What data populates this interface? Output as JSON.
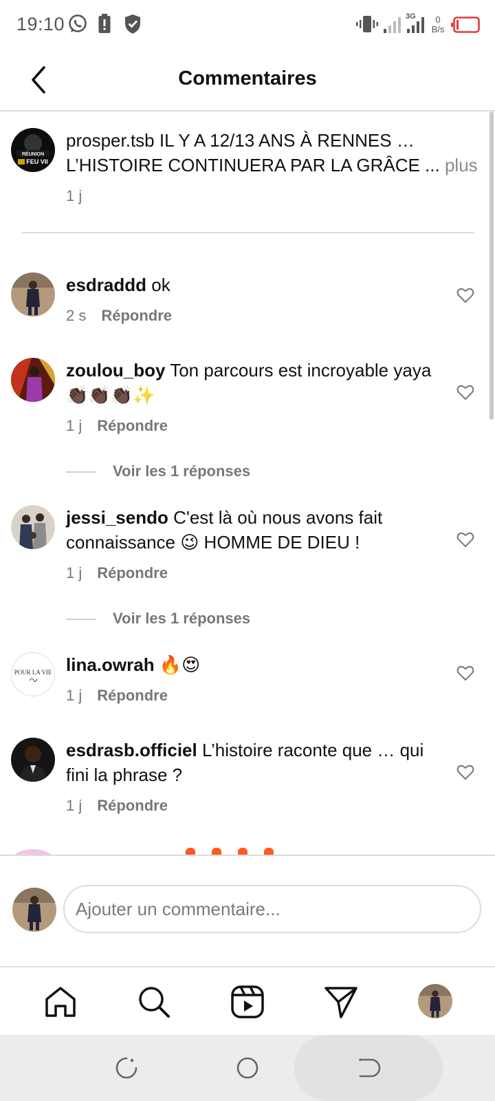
{
  "status": {
    "time": "19:10",
    "net_speed_value": "0",
    "net_speed_unit": "B/s",
    "network_type": "3G"
  },
  "header": {
    "title": "Commentaires"
  },
  "caption": {
    "username": "prosper.tsb",
    "text": "IL Y A 12/13 ANS À RENNES … L’HISTOIRE CONTINUERA PAR LA GRÂCE ...",
    "more": "plus",
    "time": "1 j"
  },
  "comments": [
    {
      "username": "esdraddd",
      "text": "ok",
      "time": "2 s",
      "reply": "Répondre"
    },
    {
      "username": "zoulou_boy",
      "text": "Ton parcours est incroyable yaya 👏🏿👏🏿👏🏿✨",
      "time": "1 j",
      "reply": "Répondre",
      "view_replies": "Voir les 1 réponses"
    },
    {
      "username": "jessi_sendo",
      "text": "C'est là où nous avons fait connaissance 😉 HOMME DE DIEU !",
      "time": "1 j",
      "reply": "Répondre",
      "view_replies": "Voir les 1 réponses"
    },
    {
      "username": "lina.owrah",
      "text": "🔥😍",
      "time": "1 j",
      "reply": "Répondre"
    },
    {
      "username": "esdrasb.officiel",
      "text": "L’histoire raconte que … qui fini la phrase ?",
      "time": "1 j",
      "reply": "Répondre"
    }
  ],
  "composer": {
    "placeholder": "Ajouter un commentaire..."
  },
  "avatar_texts": {
    "lina": "POUR LA VIE",
    "caption_logo": "RÉUNION FEU VII"
  },
  "colors": {
    "battery_red": "#e53935",
    "muted_text": "#777777",
    "divider": "#dcdcdc"
  },
  "icons": {
    "back": "arrow-left-icon",
    "heart": "heart-outline-icon",
    "home": "home-icon",
    "search": "search-icon",
    "reels": "reels-icon",
    "messages": "paper-plane-icon"
  }
}
